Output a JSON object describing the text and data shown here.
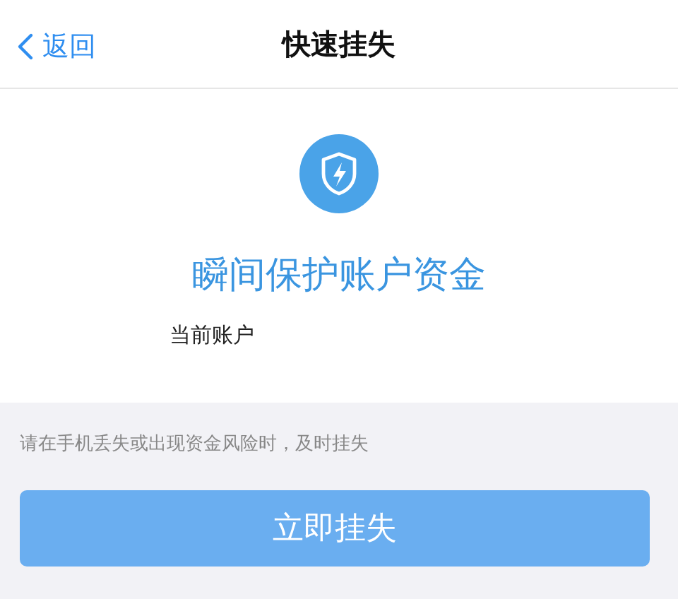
{
  "nav": {
    "back": "返回",
    "title": "快速挂失"
  },
  "protect": {
    "headline": "瞬间保护账户资金",
    "account_label": "当前账户"
  },
  "hint": "请在手机丢失或出现资金风险时，及时挂失",
  "button": "立即挂失"
}
